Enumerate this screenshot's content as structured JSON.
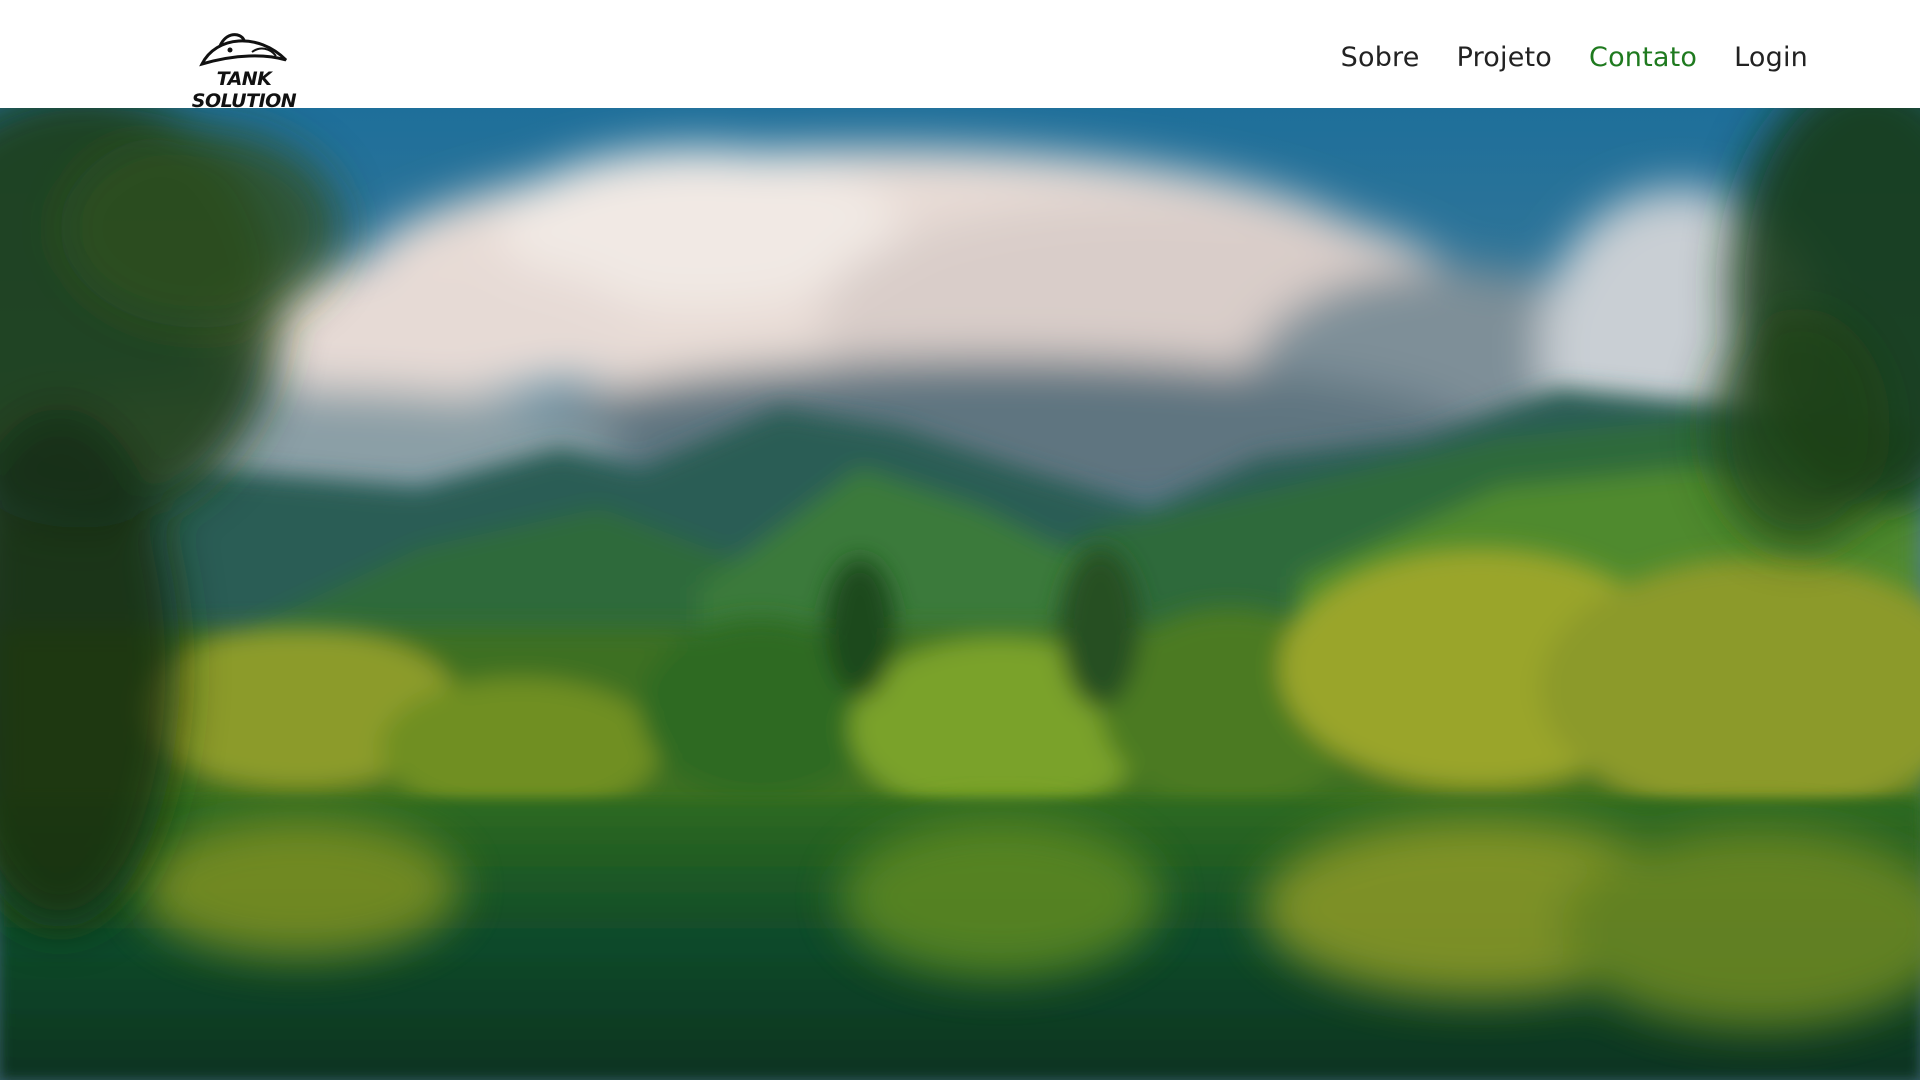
{
  "brand": {
    "logo_text": "TANK SOLUTION",
    "logo_icon": "fish-icon"
  },
  "nav": {
    "items": [
      {
        "label": "Sobre",
        "active": false
      },
      {
        "label": "Projeto",
        "active": false
      },
      {
        "label": "Contato",
        "active": true
      },
      {
        "label": "Login",
        "active": false
      }
    ],
    "active_color": "#1f7a1f"
  },
  "hero": {
    "image_subject": "blurred landscape of green forested mountains, cloudy sky and lake reflection"
  }
}
